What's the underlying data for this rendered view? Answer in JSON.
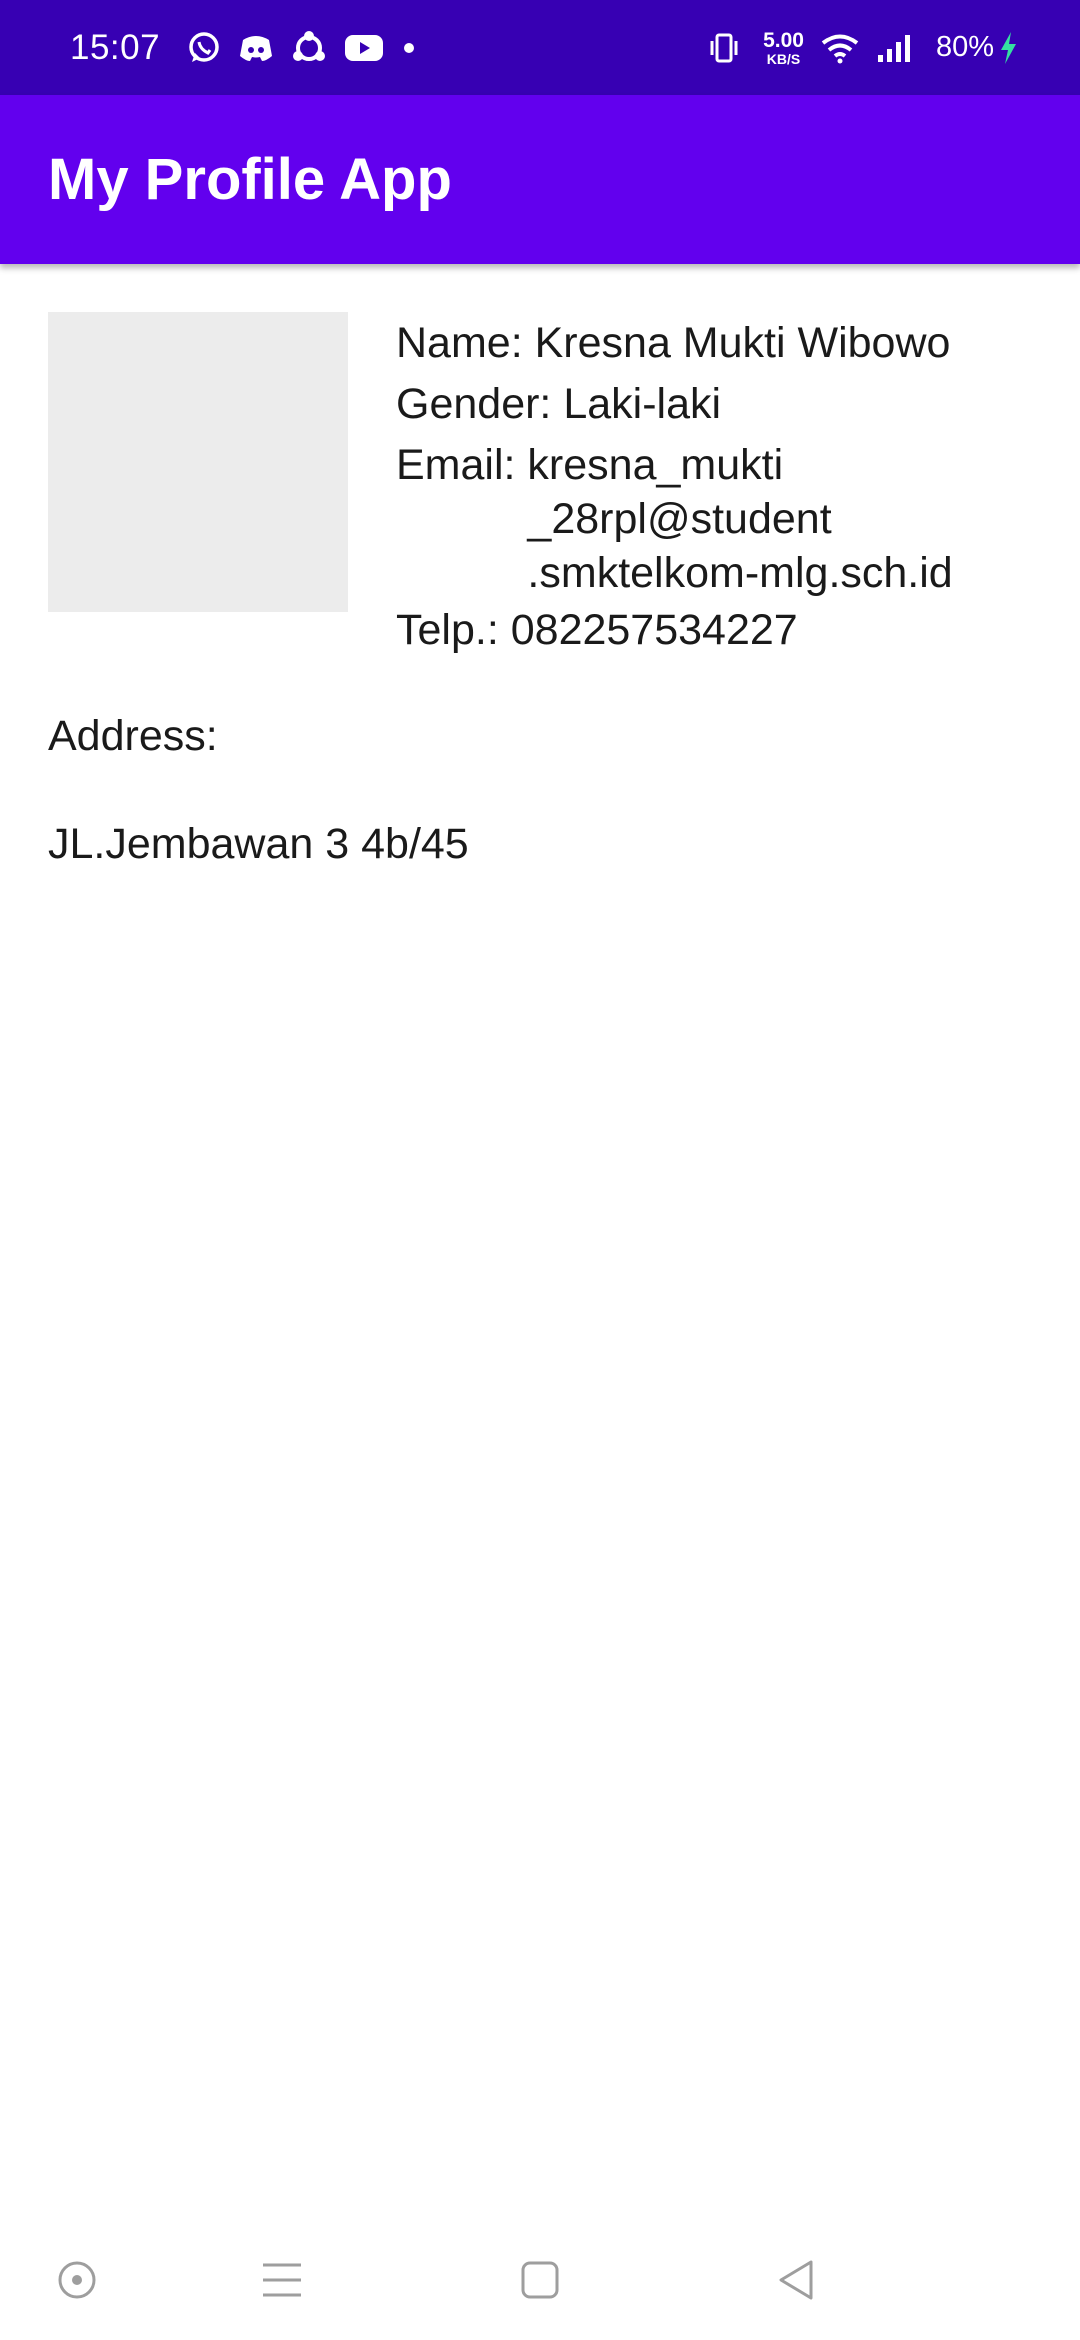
{
  "status_bar": {
    "time": "15:07",
    "notification_icons": [
      "whatsapp-icon",
      "discord-icon",
      "sync-icon",
      "youtube-icon"
    ],
    "speed_value": "5.00",
    "speed_unit": "KB/S",
    "battery": "80%",
    "colors": {
      "background": "#3700b3",
      "charging": "#34e0a1"
    }
  },
  "app_bar": {
    "title": "My Profile App",
    "color": "#6200ee"
  },
  "profile": {
    "name_label": "Name:",
    "name_value": "Kresna Mukti Wibowo",
    "gender_label": "Gender:",
    "gender_value": "Laki-laki",
    "email_label": "Email:",
    "email_lines": [
      "kresna_mukti",
      "_28rpl@student",
      ".smktelkom-mlg.sch.id"
    ],
    "telp_label": "Telp.:",
    "telp_value": "082257534227",
    "address_label": "Address:",
    "address_value": "JL.Jembawan 3 4b/45"
  },
  "nav_bar": {
    "buttons": [
      "assistant-icon",
      "menu-icon",
      "home-icon",
      "back-icon"
    ]
  }
}
